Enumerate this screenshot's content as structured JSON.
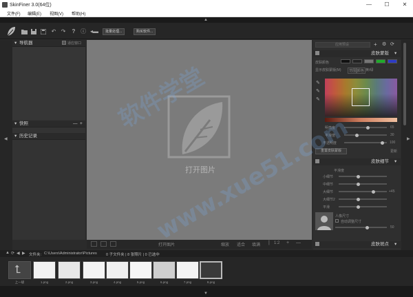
{
  "window": {
    "title": "SkinFiner 3.0(64位)",
    "controls": {
      "minimize": "—",
      "maximize": "☐",
      "close": "✕"
    }
  },
  "menu": {
    "items": [
      "文件(F)",
      "编辑(E)",
      "视图(V)",
      "帮助(H)"
    ]
  },
  "toolbar": {
    "icons": [
      "leaf-logo-icon",
      "folder-open-icon",
      "save-icon",
      "save-as-icon",
      "undo-icon",
      "redo-icon",
      "help-icon",
      "info-icon",
      "compare-icon"
    ],
    "batch_label": "批量处理...",
    "buy_label": "购买软件..."
  },
  "left_panel": {
    "navigator": {
      "title": "导航器",
      "fit_label": "适应窗口"
    },
    "snapshot": {
      "title": "快照",
      "minus": "—",
      "plus": "+"
    },
    "history": {
      "title": "历史记录"
    }
  },
  "canvas": {
    "open_label": "打开图片",
    "background": "#7b7b7b"
  },
  "canvas_bar": {
    "open_image": "打开图片",
    "zoom_items": [
      "缩放",
      "适合",
      "填满"
    ],
    "zoom_value": "1:2"
  },
  "right_panel": {
    "preset_placeholder": "应用预设",
    "skin_color": {
      "title": "皮肤蒙版",
      "skin_color_label": "皮肤颜色",
      "mask_label": "显示皮肤蒙版(M)",
      "mask_options": [
        "范围",
        "颜色",
        "黄/绿"
      ],
      "sliders": [
        {
          "label": "明亮度",
          "value": "65",
          "fraction": 0.55
        },
        {
          "label": "平滑度",
          "value": "30",
          "fraction": 0.3
        },
        {
          "label": "不透明度",
          "value": "100",
          "fraction": 0.9
        }
      ],
      "reset_label": "重置皮肤蒙版",
      "extra": "更新"
    },
    "skin_detail": {
      "title": "皮肤细节",
      "level_label": "平滑度",
      "sliders": [
        {
          "label": "小细节",
          "value": "",
          "fraction": 0.4
        },
        {
          "label": "中细节",
          "value": "",
          "fraction": 0.4
        },
        {
          "label": "大细节",
          "value": "+45",
          "fraction": 0.72
        },
        {
          "label": "大细节2",
          "value": "",
          "fraction": 0.4
        },
        {
          "label": "平滑",
          "value": "",
          "fraction": 0.4
        }
      ],
      "portrait": {
        "label": "人像尺寸",
        "option": "自动调整尺寸",
        "value": "50",
        "fraction": 0.62
      }
    },
    "skin_blemish": {
      "title": "皮肤斑点"
    }
  },
  "path_bar": {
    "label": "文件夹:",
    "path": "C:\\Users\\Administrator\\Pictures",
    "info": "0 子文件夹 | 8 张照片 | 0 已选中"
  },
  "filmstrip": {
    "up_label": "上一级",
    "items": [
      "1.png",
      "2.png",
      "3.png",
      "4.png",
      "5.png",
      "6.png",
      "7.png",
      "8.png"
    ],
    "selected_index": 7
  },
  "watermark": {
    "text": "软件学堂",
    "url": "www.xue51.com"
  },
  "colors": {
    "accent": "#3a76c4",
    "panel": "#333333",
    "canvas": "#7b7b7b"
  }
}
